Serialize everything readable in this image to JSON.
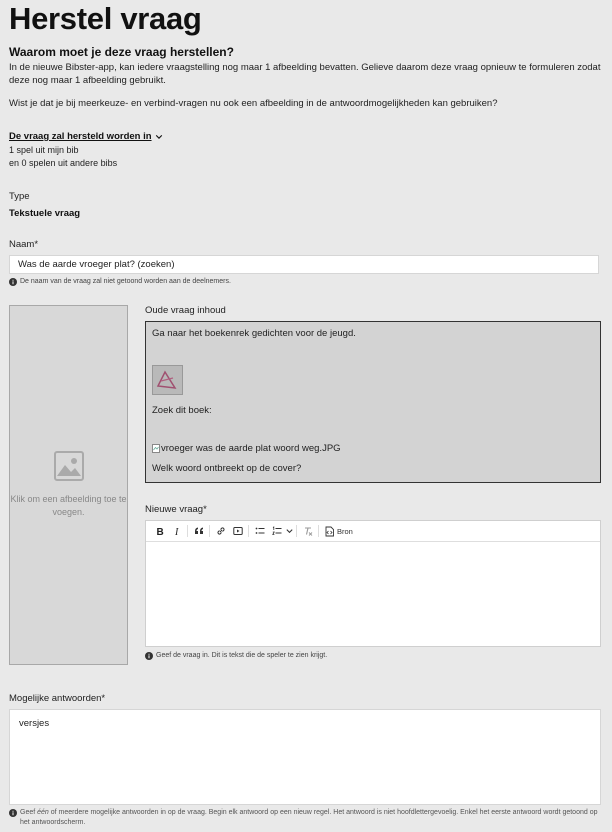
{
  "page": {
    "title": "Herstel vraag",
    "subtitle": "Waarom moet je deze vraag herstellen?",
    "intro": "In de nieuwe Bibster-app, kan iedere vraagstelling nog maar 1 afbeelding bevatten. Gelieve daarom deze vraag opnieuw te formuleren zodat deze nog maar 1 afbeelding gebruikt.",
    "tip": "Wist je dat je bij meerkeuze- en verbind-vragen nu ook een afbeelding in de antwoordmogelijkheden kan gebruiken?"
  },
  "restore": {
    "toggle_label": "De vraag zal hersteld worden in",
    "line1": "1 spel uit mijn bib",
    "line2": "en 0 spelen uit andere bibs"
  },
  "type": {
    "label": "Type",
    "value": "Tekstuele vraag"
  },
  "name": {
    "label": "Naam*",
    "value": "Was de aarde vroeger plat? (zoeken)",
    "hint": "De naam van de vraag zal niet getoond worden aan de deelnemers."
  },
  "image_drop": {
    "text": "Klik om een afbeelding toe te voegen."
  },
  "old_content": {
    "label": "Oude vraag inhoud",
    "line1": "Ga naar het boekenrek gedichten voor de jeugd.",
    "line2": "Zoek dit boek:",
    "broken_image_alt": "vroeger was de aarde plat woord weg.JPG",
    "line3": "Welk woord ontbreekt op de cover?"
  },
  "new_question": {
    "label": "Nieuwe vraag*",
    "source_label": "Bron",
    "hint": "Geef de vraag in. Dit is tekst die de speler te zien krijgt."
  },
  "answers": {
    "label": "Mogelijke antwoorden*",
    "value": "versjes",
    "hint_pre": "Geef ",
    "hint_em": "één",
    "hint_post": " of meerdere mogelijke antwoorden in op de vraag. Begin elk antwoord op een nieuw regel. Het antwoord is niet hoofdlettergevoelig. Enkel het eerste antwoord wordt getoond op het antwoordscherm."
  },
  "icons": [
    "chevron-down-icon",
    "info-icon",
    "image-placeholder-icon",
    "broken-image-icon",
    "bold-icon",
    "italic-icon",
    "quote-icon",
    "link-icon",
    "media-icon",
    "bullet-list-icon",
    "numbered-list-icon",
    "remove-format-icon",
    "source-icon"
  ]
}
